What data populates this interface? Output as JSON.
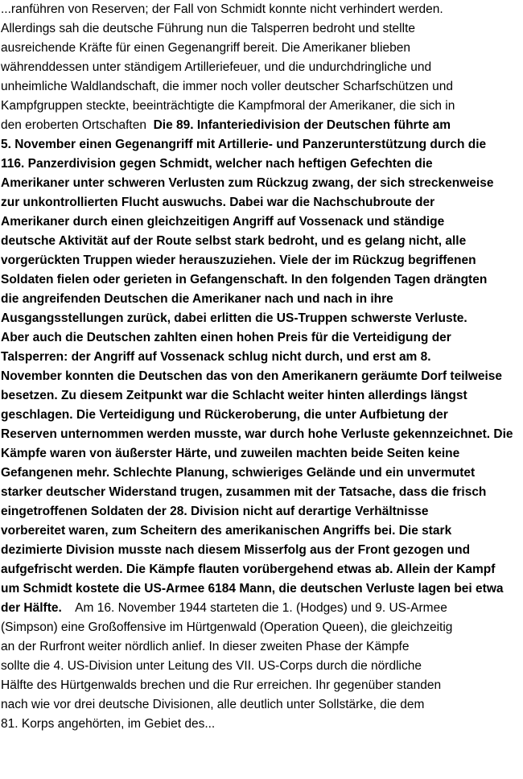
{
  "document": {
    "lines": [
      {
        "segments": [
          {
            "text": "...ranführen von Reserven; der Fall von Schmidt konnte nicht verhindert werden.",
            "bold": false
          }
        ]
      },
      {
        "segments": [
          {
            "text": "Allerdings sah die deutsche Führung nun die Talsperren bedroht und stellte",
            "bold": false
          }
        ]
      },
      {
        "segments": [
          {
            "text": "ausreichende Kräfte für einen Gegenangriff bereit. Die Amerikaner blieben",
            "bold": false
          }
        ]
      },
      {
        "segments": [
          {
            "text": "währenddessen unter ständigem Artilleriefeuer, und die undurchdringliche und",
            "bold": false
          }
        ]
      },
      {
        "segments": [
          {
            "text": "unheimliche Waldlandschaft, die immer noch voller deutscher Scharfschützen und",
            "bold": false
          }
        ]
      },
      {
        "segments": [
          {
            "text": "Kampfgruppen steckte, beeinträchtigte die Kampfmoral der Amerikaner, die sich in",
            "bold": false
          }
        ]
      },
      {
        "segments": [
          {
            "text": "den eroberten Ortschaften  ",
            "bold": false
          },
          {
            "text": "Die 89. Infanteriedivision der Deutschen führte am",
            "bold": true
          }
        ]
      },
      {
        "segments": [
          {
            "text": "5. November einen Gegenangriff mit Artillerie- und Panzerunterstützung durch die",
            "bold": true
          }
        ]
      },
      {
        "segments": [
          {
            "text": "116. Panzerdivision gegen Schmidt, welcher nach heftigen Gefechten die",
            "bold": true
          }
        ]
      },
      {
        "segments": [
          {
            "text": "Amerikaner unter schweren Verlusten zum Rückzug zwang, der sich streckenweise",
            "bold": true
          }
        ]
      },
      {
        "segments": [
          {
            "text": "zur unkontrollierten Flucht auswuchs. Dabei war die Nachschubroute der",
            "bold": true
          }
        ]
      },
      {
        "segments": [
          {
            "text": "Amerikaner durch einen gleichzeitigen Angriff auf Vossenack und ständige",
            "bold": true
          }
        ]
      },
      {
        "segments": [
          {
            "text": "deutsche Aktivität auf der Route selbst stark bedroht, und es gelang nicht, alle",
            "bold": true
          }
        ]
      },
      {
        "segments": [
          {
            "text": "vorgerückten Truppen wieder herauszuziehen. Viele der im Rückzug begriffenen",
            "bold": true
          }
        ]
      },
      {
        "segments": [
          {
            "text": "Soldaten fielen oder gerieten in Gefangenschaft. In den folgenden Tagen drängten",
            "bold": true
          }
        ]
      },
      {
        "segments": [
          {
            "text": "die angreifenden Deutschen die Amerikaner nach und nach in ihre",
            "bold": true
          }
        ]
      },
      {
        "segments": [
          {
            "text": "Ausgangsstellungen zurück, dabei erlitten die US-Truppen schwerste Verluste.",
            "bold": true
          }
        ]
      },
      {
        "segments": [
          {
            "text": "Aber auch die Deutschen zahlten einen hohen Preis für die Verteidigung der",
            "bold": true
          }
        ]
      },
      {
        "segments": [
          {
            "text": "Talsperren: der Angriff auf Vossenack schlug nicht durch, und erst am 8.",
            "bold": true
          }
        ]
      },
      {
        "segments": [
          {
            "text": "November konnten die Deutschen das von den Amerikanern geräumte Dorf teilweise",
            "bold": true
          }
        ]
      },
      {
        "segments": [
          {
            "text": "besetzen. Zu diesem Zeitpunkt war die Schlacht weiter hinten allerdings längst",
            "bold": true
          }
        ]
      },
      {
        "segments": [
          {
            "text": "geschlagen. Die Verteidigung und Rückeroberung, die unter Aufbietung der",
            "bold": true
          }
        ]
      },
      {
        "segments": [
          {
            "text": "Reserven unternommen werden musste, war durch hohe Verluste gekennzeichnet. Die",
            "bold": true
          }
        ]
      },
      {
        "segments": [
          {
            "text": "Kämpfe waren von äußerster Härte, und zuweilen machten beide Seiten keine",
            "bold": true
          }
        ]
      },
      {
        "segments": [
          {
            "text": "Gefangenen mehr. Schlechte Planung, schwieriges Gelände und ein unvermutet",
            "bold": true
          }
        ]
      },
      {
        "segments": [
          {
            "text": "starker deutscher Widerstand trugen, zusammen mit der Tatsache, dass die frisch",
            "bold": true
          }
        ]
      },
      {
        "segments": [
          {
            "text": "eingetroffenen Soldaten der 28. Division nicht auf derartige Verhältnisse",
            "bold": true
          }
        ]
      },
      {
        "segments": [
          {
            "text": "vorbereitet waren, zum Scheitern des amerikanischen Angriffs bei. Die stark",
            "bold": true
          }
        ]
      },
      {
        "segments": [
          {
            "text": "dezimierte Division musste nach diesem Misserfolg aus der Front gezogen und",
            "bold": true
          }
        ]
      },
      {
        "segments": [
          {
            "text": "aufgefrischt werden. Die Kämpfe flauten vorübergehend etwas ab. Allein der Kampf",
            "bold": true
          }
        ]
      },
      {
        "segments": [
          {
            "text": "um Schmidt kostete die US-Armee 6184 Mann, die deutschen Verluste lagen bei etwa",
            "bold": true
          }
        ]
      },
      {
        "segments": [
          {
            "text": "der Hälfte.",
            "bold": true
          },
          {
            "text": "    Am 16. November 1944 starteten die 1. (Hodges) und 9. US-Armee",
            "bold": false
          }
        ]
      },
      {
        "segments": [
          {
            "text": "(Simpson) eine Großoffensive im Hürtgenwald (Operation Queen), die gleichzeitig",
            "bold": false
          }
        ]
      },
      {
        "segments": [
          {
            "text": "an der Rurfront weiter nördlich anlief. In dieser zweiten Phase der Kämpfe",
            "bold": false
          }
        ]
      },
      {
        "segments": [
          {
            "text": "sollte die 4. US-Division unter Leitung des VII. US-Corps durch die nördliche",
            "bold": false
          }
        ]
      },
      {
        "segments": [
          {
            "text": "Hälfte des Hürtgenwalds brechen und die Rur erreichen. Ihr gegenüber standen",
            "bold": false
          }
        ]
      },
      {
        "segments": [
          {
            "text": "nach wie vor drei deutsche Divisionen, alle deutlich unter Sollstärke, die dem",
            "bold": false
          }
        ]
      },
      {
        "segments": [
          {
            "text": "81. Korps angehörten, im Gebiet des...",
            "bold": false
          }
        ]
      }
    ]
  }
}
